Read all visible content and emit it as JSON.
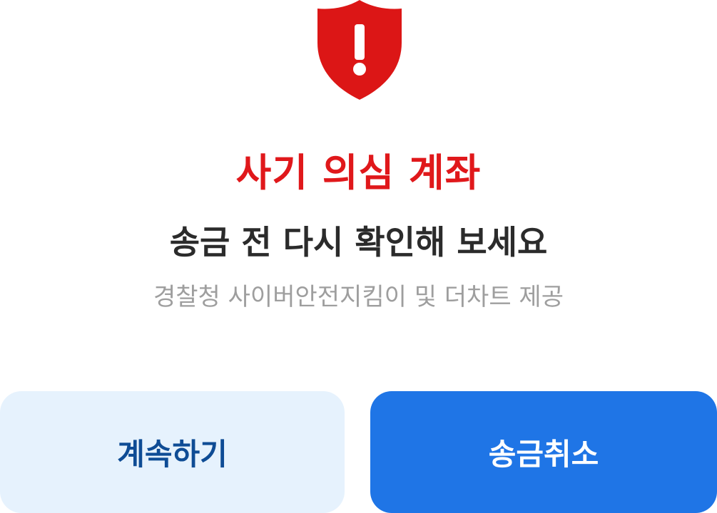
{
  "alert": {
    "icon": "warning-shield-icon",
    "icon_color": "#dc1616",
    "title": "사기 의심 계좌",
    "subtitle": "송금 전 다시 확인해 보세요",
    "provider": "경찰청 사이버안전지킴이 및 더차트 제공"
  },
  "actions": {
    "continue_label": "계속하기",
    "cancel_label": "송금취소"
  },
  "colors": {
    "title": "#e0181b",
    "subtitle": "#2b2b2b",
    "provider": "#9e9e9e",
    "continue_bg": "#e6f2fd",
    "continue_text": "#0e4c95",
    "cancel_bg": "#1f75e6",
    "cancel_text": "#ffffff"
  }
}
